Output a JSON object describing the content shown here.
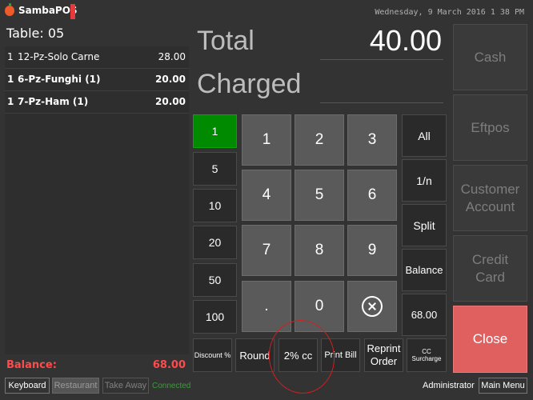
{
  "app": {
    "name": "SambaPOS",
    "datetime": "Wednesday, 9 March 2016 1 38 PM"
  },
  "order": {
    "table": "Table: 05",
    "lines": [
      {
        "qty": "1",
        "name": "12-Pz-Solo Carne",
        "price": "28.00"
      },
      {
        "qty": "1",
        "name": "6-Pz-Funghi (1)",
        "price": "20.00"
      },
      {
        "qty": "1",
        "name": "7-Pz-Ham (1)",
        "price": "20.00"
      }
    ],
    "balance_label": "Balance:",
    "balance_value": "68.00"
  },
  "totals": {
    "total_label": "Total",
    "total_value": "40.00",
    "charged_label": "Charged"
  },
  "amounts": [
    "1",
    "5",
    "10",
    "20",
    "50",
    "100"
  ],
  "keypad": [
    "1",
    "2",
    "3",
    "4",
    "5",
    "6",
    "7",
    "8",
    "9",
    ".",
    "0"
  ],
  "split": {
    "all": "All",
    "one_n": "1/n",
    "split": "Split",
    "balance": "Balance",
    "remaining": "68.00"
  },
  "actions": {
    "discount": "Discount %",
    "round": "Round",
    "cc2": "2% cc",
    "print_bill": "Print Bill",
    "reprint_l1": "Reprint",
    "reprint_l2": "Order",
    "cc_surcharge": "CC Surcharge"
  },
  "payments": {
    "cash": "Cash",
    "eftpos": "Eftpos",
    "customer_l1": "Customer",
    "customer_l2": "Account",
    "credit_l1": "Credit",
    "credit_l2": "Card",
    "close": "Close"
  },
  "footer": {
    "keyboard": "Keyboard",
    "restaurant": "Restaurant",
    "takeaway": "Take Away",
    "connected": "Connected",
    "user": "Administrator",
    "main_menu": "Main Menu"
  },
  "colors": {
    "accent_green": "#008a00",
    "close_red": "#e06060",
    "balance_red": "#ff4b4b"
  },
  "icons": {
    "clear": "clear-icon",
    "logo": "samba-logo-icon"
  }
}
